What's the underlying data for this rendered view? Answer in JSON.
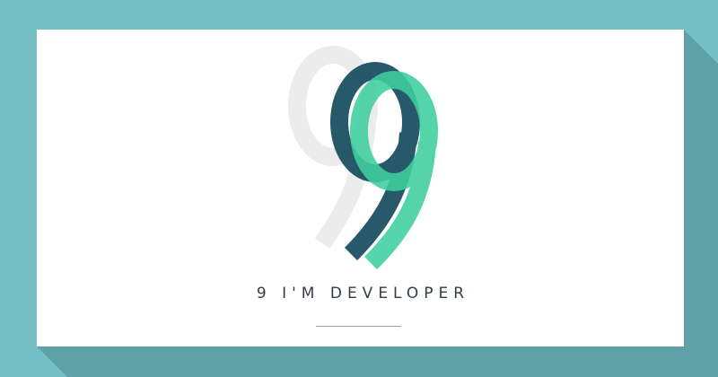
{
  "background": {
    "color": "#74c0c6",
    "shadow_color": "#5ea2a7"
  },
  "logo": {
    "glyph": "9",
    "layers": [
      {
        "name": "shadow",
        "color": "#ececec"
      },
      {
        "name": "dark",
        "color": "#215466"
      },
      {
        "name": "teal",
        "color": "#3ecf9f"
      }
    ]
  },
  "tagline": {
    "text": "9 I'M DEVELOPER",
    "color": "#333d47"
  },
  "divider": {
    "color": "#9aa3a8"
  }
}
